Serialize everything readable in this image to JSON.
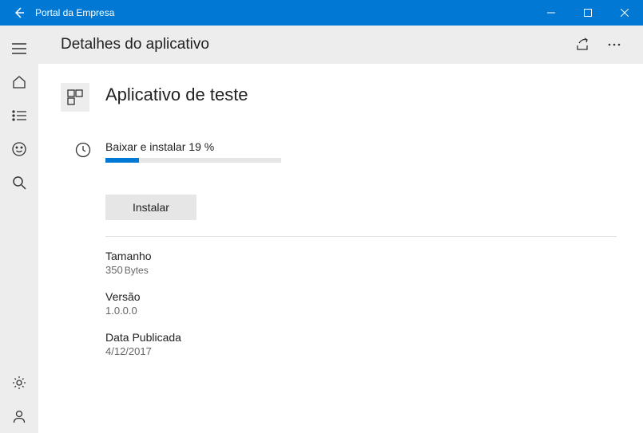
{
  "window": {
    "title": "Portal da Empresa"
  },
  "header": {
    "title": "Detalhes do aplicativo"
  },
  "app": {
    "name": "Aplicativo de teste",
    "status_label": "Baixar e instalar",
    "progress_percent": 19,
    "progress_suffix": "%",
    "install_button": "Instalar",
    "meta": {
      "size_label": "Tamanho",
      "size_value": "350",
      "size_unit": "Bytes",
      "version_label": "Versão",
      "version_value": "1.0.0.0",
      "published_label": "Data Publicada",
      "published_value": "4/12/2017"
    }
  },
  "colors": {
    "accent": "#0078d4"
  }
}
